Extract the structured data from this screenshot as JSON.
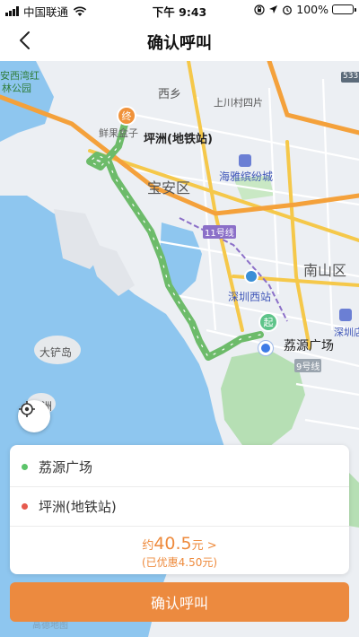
{
  "status_bar": {
    "carrier": "中国联通",
    "time": "下午 9:43",
    "battery_text": "100%",
    "battery_level": 1.0,
    "icons": [
      "signal-icon",
      "wifi-icon",
      "lock-rotation-icon",
      "location-arrow-icon",
      "alarm-icon",
      "battery-icon"
    ]
  },
  "header": {
    "title": "确认呼叫",
    "back_icon": "chevron-left-icon"
  },
  "map": {
    "labels": {
      "west_bay_park_1": "安西湾红",
      "west_bay_park_2": "林公园",
      "xixiang": "西乡",
      "shangchuan": "上川村四片",
      "pingzhou_top": "坪洲(地铁站)",
      "xianguo": "鲜果盒子",
      "destination_marker": "终",
      "baoan": "宝安区",
      "haiya": "海雅缤纷城",
      "line11": "11号线",
      "nanshan": "南山区",
      "shenzhen_west": "深圳西站",
      "start_marker": "起",
      "liyuan": "荔源广场",
      "line9": "9号线",
      "shenzhen_store": "深圳店",
      "dachan": "大铲岛",
      "island_small": "孖洲",
      "road_shield": "533",
      "map_watermark": "高德地图"
    },
    "colors": {
      "water": "#8ec6ef",
      "land": "#eceff3",
      "green_space": "#b6dfb4",
      "route": "#6dbb6a",
      "major_road": "#f5c84a",
      "expressway": "#f4a13b",
      "start": "#5fc48a",
      "end": "#f0923a"
    }
  },
  "locate_button": {
    "icon": "locate-crosshair-icon"
  },
  "trip": {
    "origin": "荔源广场",
    "destination": "坪洲(地铁站)",
    "origin_dot_color": "#5cc46a",
    "destination_dot_color": "#e65a4e",
    "price_prefix": "约",
    "price_amount": "40.5",
    "price_suffix": "元 >",
    "discount": "(已优惠4.50元)"
  },
  "confirm_button": {
    "label": "确认呼叫"
  }
}
